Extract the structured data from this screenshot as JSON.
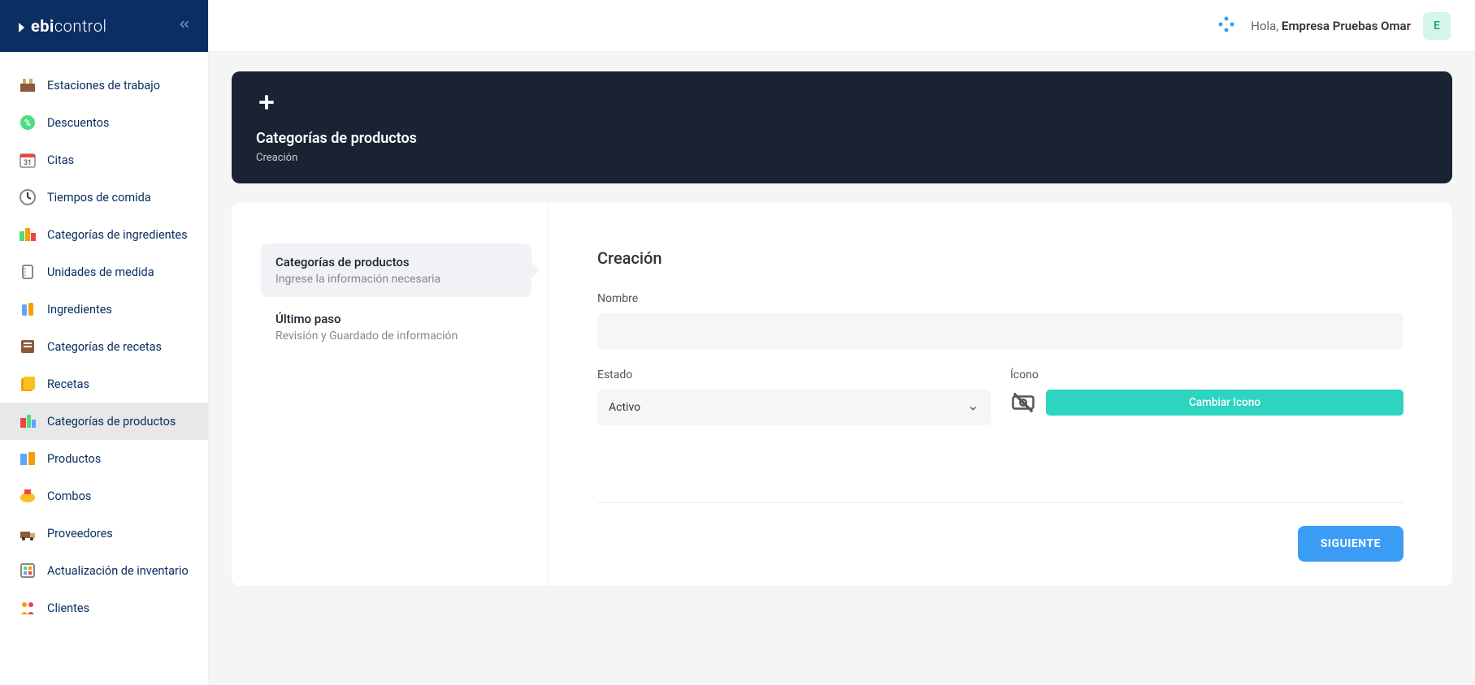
{
  "logo": {
    "part1": "ebi",
    "part2": "control"
  },
  "sidebar": {
    "items": [
      {
        "label": "Estaciones de trabajo",
        "icon": "workstations-icon"
      },
      {
        "label": "Descuentos",
        "icon": "discounts-icon"
      },
      {
        "label": "Citas",
        "icon": "appointments-icon"
      },
      {
        "label": "Tiempos de comida",
        "icon": "mealtimes-icon"
      },
      {
        "label": "Categorías de ingredientes",
        "icon": "ingredient-categories-icon"
      },
      {
        "label": "Unidades de medida",
        "icon": "units-icon"
      },
      {
        "label": "Ingredientes",
        "icon": "ingredients-icon"
      },
      {
        "label": "Categorías de recetas",
        "icon": "recipe-categories-icon"
      },
      {
        "label": "Recetas",
        "icon": "recipes-icon"
      },
      {
        "label": "Categorías de productos",
        "icon": "product-categories-icon",
        "active": true
      },
      {
        "label": "Productos",
        "icon": "products-icon"
      },
      {
        "label": "Combos",
        "icon": "combos-icon"
      },
      {
        "label": "Proveedores",
        "icon": "suppliers-icon"
      },
      {
        "label": "Actualización de inventario",
        "icon": "inventory-update-icon"
      },
      {
        "label": "Clientes",
        "icon": "clients-icon"
      }
    ]
  },
  "topbar": {
    "greeting_prefix": "Hola, ",
    "user_name": "Empresa Pruebas Omar",
    "avatar_letter": "E"
  },
  "header": {
    "title": "Categorías de productos",
    "subtitle": "Creación"
  },
  "steps": [
    {
      "title": "Categorías de productos",
      "sub": "Ingrese la información necesaria",
      "active": true
    },
    {
      "title": "Último paso",
      "sub": "Revisión y Guardado de información"
    }
  ],
  "form": {
    "heading": "Creación",
    "name_label": "Nombre",
    "name_value": "",
    "status_label": "Estado",
    "status_value": "Activo",
    "icon_label": "Ícono",
    "change_icon_btn": "Cambiar Icono",
    "next_btn": "SIGUIENTE"
  }
}
